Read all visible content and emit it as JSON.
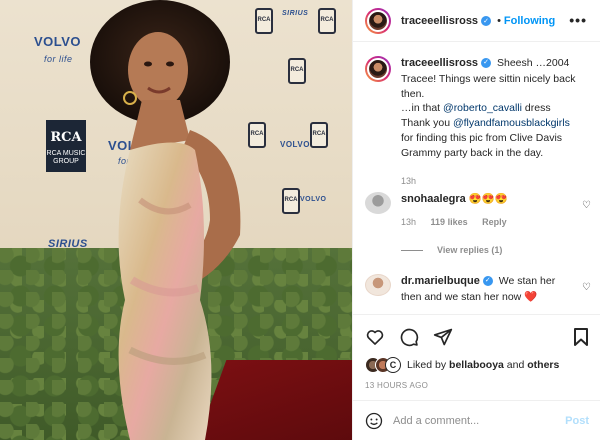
{
  "photo": {
    "sponsor_texts": [
      "VOLVO",
      "for life",
      "VOLVO",
      "for life",
      "SIRIUS",
      "VOLVO",
      "RCA",
      "RCA MUSIC GROUP",
      "RCA",
      "VOLVO",
      "SIRIUS",
      "VOLVO"
    ],
    "rca": {
      "logo": "RCA",
      "caption": "RCA MUSIC GROUP"
    }
  },
  "post": {
    "username": "traceeellisross",
    "follow_label": "Following",
    "separator": "•",
    "more_icon": "more-horizontal-icon",
    "more_label": "•••"
  },
  "caption": {
    "username": "traceeellisross",
    "text_a": " Sheesh …2004 Tracee! Things were sittin nicely back then.",
    "text_b": "…in that ",
    "mention_a": "@roberto_cavalli",
    "text_c": " dress",
    "text_d": "Thank you ",
    "mention_b": "@flyandfamousblackgirls",
    "text_e": " for finding this pic from Clive Davis Grammy party back in the day.",
    "time": "13h"
  },
  "comments": [
    {
      "username": "snohaalegra",
      "text": " 😍😍😍",
      "time": "13h",
      "likes": "119 likes",
      "reply_label": "Reply",
      "view_replies": "View replies (1)"
    },
    {
      "username": "dr.marielbuque",
      "text": " We stan her then and we stan her now ❤️"
    }
  ],
  "actions": {
    "liked_prefix": "Liked by ",
    "liked_user": "bellabooya",
    "liked_and": " and ",
    "liked_others": "others",
    "timestamp": "13 HOURS AGO",
    "stack_letter": "C"
  },
  "compose": {
    "placeholder": "Add a comment...",
    "post_label": "Post"
  },
  "colors": {
    "accent": "#0095f6",
    "verified": "#3897f0",
    "post_disabled": "#b2dffc"
  }
}
